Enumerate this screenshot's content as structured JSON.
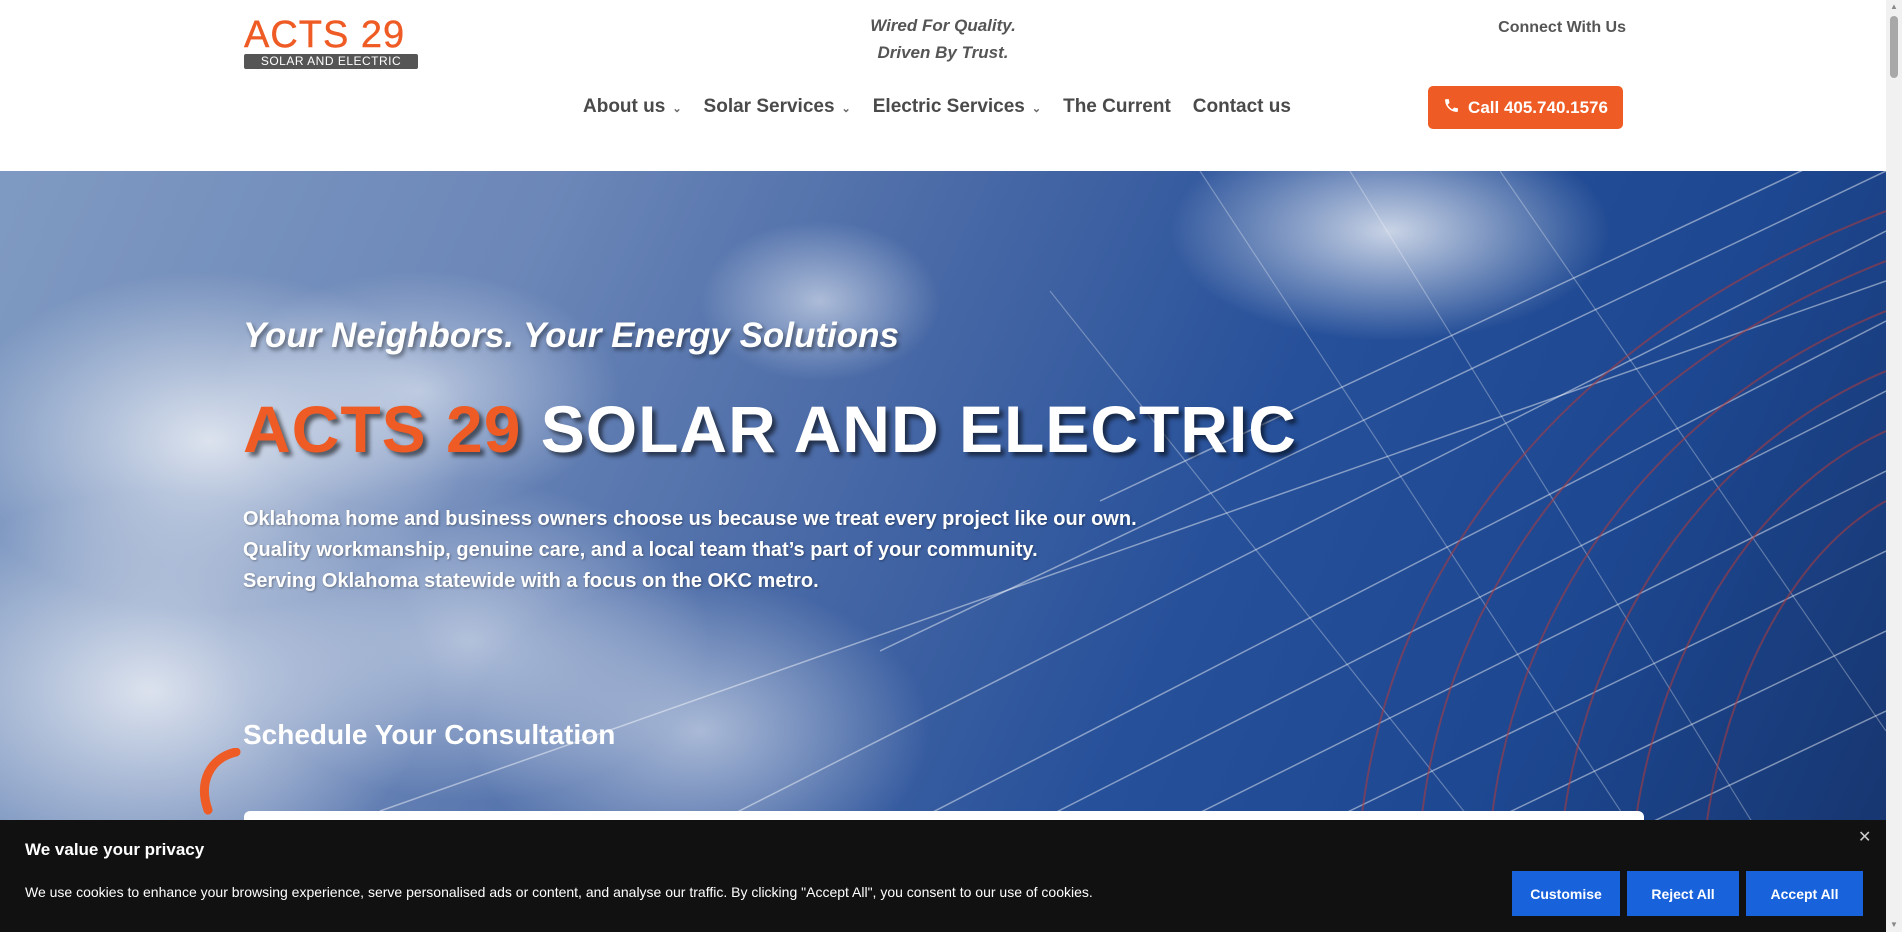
{
  "header": {
    "logo_main": "ACTS 29",
    "logo_sub": "SOLAR AND ELECTRIC",
    "tagline_line1": "Wired For Quality.",
    "tagline_line2": "Driven By Trust.",
    "connect_label": "Connect With Us",
    "nav": [
      {
        "label": "About us",
        "has_dropdown": true
      },
      {
        "label": "Solar Services",
        "has_dropdown": true
      },
      {
        "label": "Electric Services",
        "has_dropdown": true
      },
      {
        "label": "The Current",
        "has_dropdown": false
      },
      {
        "label": "Contact us",
        "has_dropdown": false
      }
    ],
    "call_label": "Call 405.740.1576",
    "call_icon": "phone-icon"
  },
  "hero": {
    "subtitle": "Your Neighbors. Your Energy Solutions",
    "title_accent": "ACTS 29",
    "title_rest": " SOLAR AND ELECTRIC",
    "body_line1": "Oklahoma home and business owners choose us because we treat every project like our own.",
    "body_line2": "Quality workmanship, genuine care, and a local team that’s part of your community.",
    "body_line3": "Serving Oklahoma statewide with a focus on the OKC metro.",
    "schedule_heading": "Schedule Your Consultation"
  },
  "cookie": {
    "title": "We value your privacy",
    "text": "We use cookies to enhance your browsing experience, serve personalised ads or content, and analyse our traffic. By clicking \"Accept All\", you consent to our use of cookies.",
    "customise_label": "Customise",
    "reject_label": "Reject All",
    "accept_label": "Accept All",
    "close_glyph": "✕"
  },
  "colors": {
    "brand_orange": "#ef5b24",
    "button_blue": "#1863dc",
    "banner_bg": "#111111"
  }
}
